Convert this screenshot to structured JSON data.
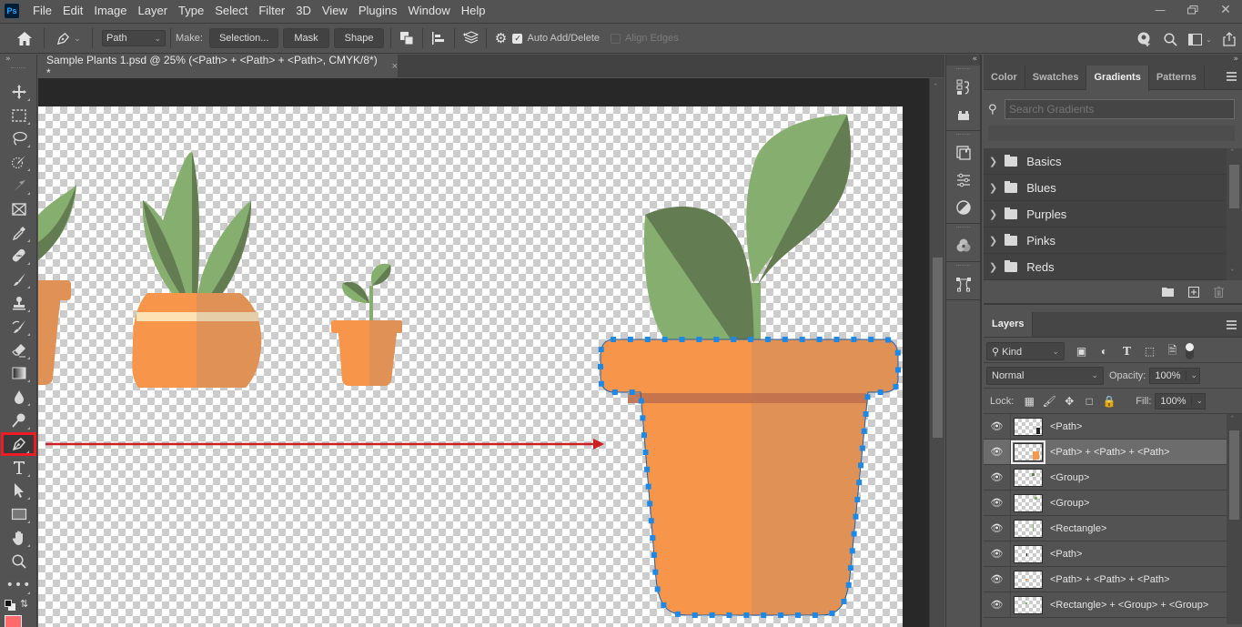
{
  "app": {
    "logo": "Ps",
    "menu": [
      "File",
      "Edit",
      "Image",
      "Layer",
      "Type",
      "Select",
      "Filter",
      "3D",
      "View",
      "Plugins",
      "Window",
      "Help"
    ],
    "window_controls": {
      "minimize": "minimize-icon",
      "restore": "restore-icon",
      "close": "close-icon"
    }
  },
  "options_bar": {
    "home_icon": "home-icon",
    "tool_icon": "pen-tool-icon",
    "mode_value": "Path",
    "make_label": "Make:",
    "selection_label": "Selection...",
    "mask_label": "Mask",
    "shape_label": "Shape",
    "auto_add_delete_label": "Auto Add/Delete",
    "auto_add_delete_checked": true,
    "align_edges_label": "Align Edges",
    "align_edges_checked": false
  },
  "document": {
    "tab_title": "Sample Plants 1.psd @ 25% (<Path> + <Path> + <Path>, CMYK/8*) *",
    "close_glyph": "×",
    "zoom_percent": 25,
    "color_mode": "CMYK/8"
  },
  "colors": {
    "pot_light": "#f7964a",
    "pot_dark": "#e09155",
    "pot_band": "#c0704d",
    "leaf_light": "#86af6f",
    "leaf_dark": "#637c52",
    "pot_stripe": "#fde2b3",
    "path_anchor": "#1e88e5",
    "annotation_arrow": "#cc1f1f",
    "active_tool_highlight": "#ec1c24",
    "quick_mask_swatch": "#ff6b6b"
  },
  "toolbar": {
    "tools": [
      {
        "name": "move-tool",
        "icon": "move-icon"
      },
      {
        "name": "marquee-tool",
        "icon": "rectangular-marquee-icon"
      },
      {
        "name": "lasso-tool",
        "icon": "lasso-icon"
      },
      {
        "name": "quick-selection-tool",
        "icon": "quick-selection-icon"
      },
      {
        "name": "crop-tool",
        "icon": "crop-icon"
      },
      {
        "name": "frame-tool",
        "icon": "frame-icon"
      },
      {
        "name": "eyedropper-tool",
        "icon": "eyedropper-icon"
      },
      {
        "name": "healing-brush-tool",
        "icon": "bandage-icon"
      },
      {
        "name": "brush-tool",
        "icon": "brush-icon"
      },
      {
        "name": "clone-stamp-tool",
        "icon": "stamp-icon"
      },
      {
        "name": "history-brush-tool",
        "icon": "history-brush-icon"
      },
      {
        "name": "eraser-tool",
        "icon": "eraser-icon"
      },
      {
        "name": "gradient-tool",
        "icon": "gradient-icon"
      },
      {
        "name": "blur-tool",
        "icon": "drop-icon"
      },
      {
        "name": "dodge-tool",
        "icon": "dodge-icon"
      },
      {
        "name": "pen-tool",
        "icon": "pen-icon",
        "active": true
      },
      {
        "name": "type-tool",
        "icon": "type-icon"
      },
      {
        "name": "path-selection-tool",
        "icon": "arrow-icon"
      },
      {
        "name": "rectangle-tool",
        "icon": "rectangle-icon"
      },
      {
        "name": "hand-tool",
        "icon": "hand-icon"
      },
      {
        "name": "zoom-tool",
        "icon": "zoom-icon"
      },
      {
        "name": "edit-toolbar",
        "icon": "more-icon"
      }
    ]
  },
  "gradients_panel": {
    "tabs": [
      "Color",
      "Swatches",
      "Gradients",
      "Patterns"
    ],
    "active_tab": "Gradients",
    "search_placeholder": "Search Gradients",
    "folders": [
      "Basics",
      "Blues",
      "Purples",
      "Pinks",
      "Reds"
    ]
  },
  "layers_panel": {
    "tab": "Layers",
    "filter_kind": "Kind",
    "blend_mode": "Normal",
    "opacity_label": "Opacity:",
    "opacity_value": "100%",
    "lock_label": "Lock:",
    "fill_label": "Fill:",
    "fill_value": "100%",
    "layers": [
      {
        "name": "<Path>",
        "visible": true,
        "selected": false
      },
      {
        "name": "<Path> + <Path> + <Path>",
        "visible": true,
        "selected": true
      },
      {
        "name": "<Group>",
        "visible": true,
        "selected": false
      },
      {
        "name": "<Group>",
        "visible": true,
        "selected": false
      },
      {
        "name": "<Rectangle>",
        "visible": true,
        "selected": false
      },
      {
        "name": "<Path>",
        "visible": true,
        "selected": false
      },
      {
        "name": "<Path> + <Path> + <Path>",
        "visible": true,
        "selected": false
      },
      {
        "name": "<Rectangle> + <Group> + <Group>",
        "visible": true,
        "selected": false
      }
    ]
  }
}
